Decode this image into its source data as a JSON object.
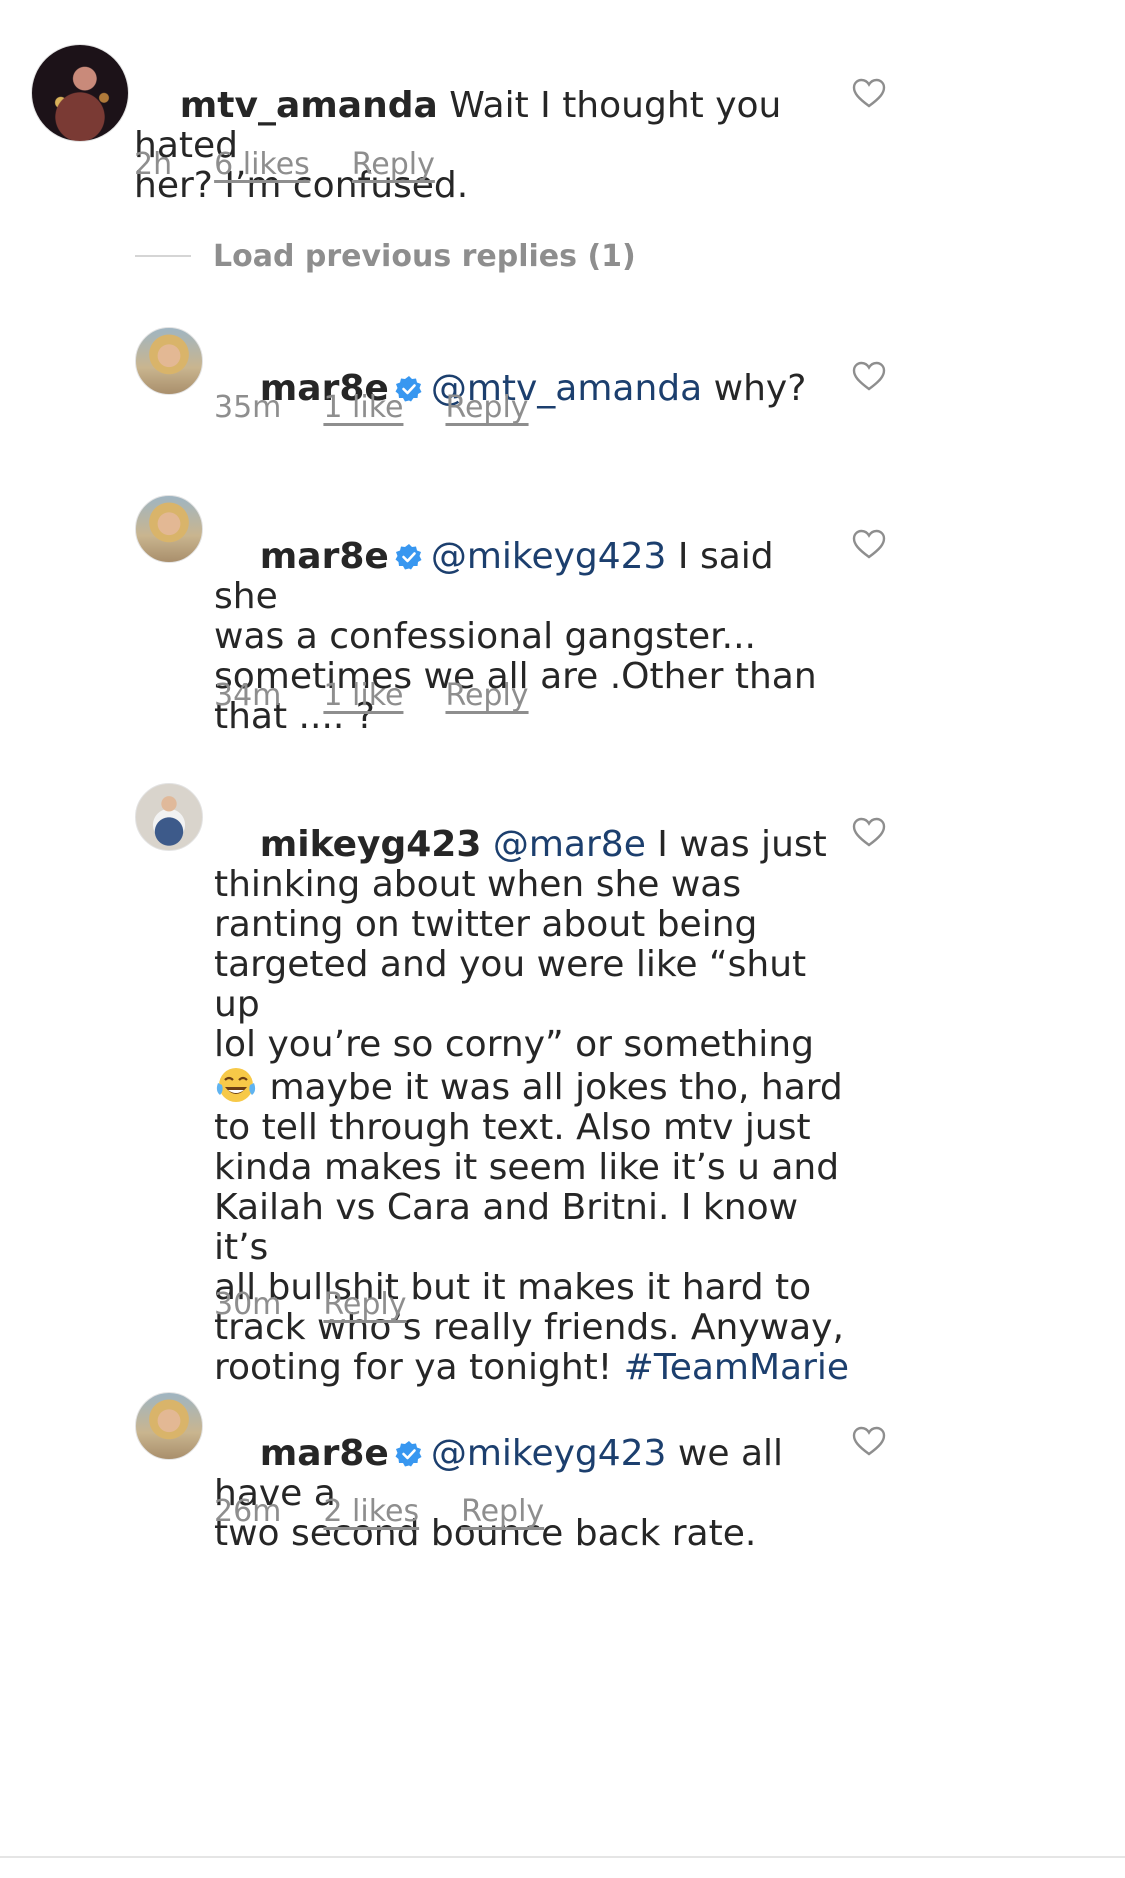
{
  "comments": [
    {
      "username": "mtv_amanda",
      "verified": false,
      "mention": "",
      "text_lines": [
        "Wait I thought you hated",
        "her? I’m confused."
      ],
      "time": "2h",
      "likes": "6 likes",
      "reply": "Reply"
    },
    {
      "username": "mar8e",
      "verified": true,
      "mention": "@mtv_amanda",
      "text": "why?",
      "time": "35m",
      "likes": "1 like",
      "reply": "Reply"
    },
    {
      "username": "mar8e",
      "verified": true,
      "mention": "@mikeyg423",
      "text_lines": [
        "I said she",
        "was a confessional gangster...",
        "sometimes we all are .Other than",
        "that .... ?"
      ],
      "time": "34m",
      "likes": "1 like",
      "reply": "Reply"
    },
    {
      "username": "mikeyg423",
      "verified": false,
      "mention": "@mar8e",
      "text_lines": [
        "I was just",
        "thinking about when she was",
        "ranting on twitter about being",
        "targeted and you were like “shut up",
        "lol you’re so corny” or something",
        " maybe it was all jokes tho, hard",
        "to tell through text. Also mtv just",
        "kinda makes it seem like it’s u and",
        "Kailah vs Cara and Britni. I know it’s",
        "all bullshit but it makes it hard to",
        "track who’s really friends. Anyway,",
        "rooting for ya tonight! "
      ],
      "hashtag": "#TeamMarie",
      "emoji": "face-with-tears-of-joy-icon",
      "time": "30m",
      "reply": "Reply"
    },
    {
      "username": "mar8e",
      "verified": true,
      "mention": "@mikeyg423",
      "text_lines": [
        "we all have a",
        "two second bounce back rate."
      ],
      "time": "26m",
      "likes": "2 likes",
      "reply": "Reply"
    }
  ],
  "load_previous": "Load previous replies (1)",
  "colors": {
    "text": "#262626",
    "meta": "#8e8e8e",
    "mention": "#1c3f6e",
    "verified": "#3897f0"
  }
}
